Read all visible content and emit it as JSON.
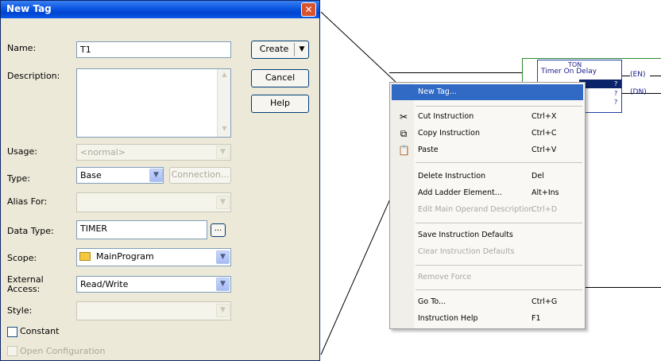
{
  "dialog": {
    "title": "New Tag",
    "name_label": "Name:",
    "name_value": "T1",
    "description_label": "Description:",
    "description_value": "",
    "usage_label": "Usage:",
    "usage_value": "<normal>",
    "type_label": "Type:",
    "type_value": "Base",
    "connection_button": "Connection...",
    "alias_label": "Alias For:",
    "alias_value": "",
    "datatype_label": "Data Type:",
    "datatype_value": "TIMER",
    "browse_button": "...",
    "scope_label": "Scope:",
    "scope_value": "MainProgram",
    "external_access_label": "External Access:",
    "external_access_value": "Read/Write",
    "style_label": "Style:",
    "style_value": "",
    "constant_label": "Constant",
    "open_config_label": "Open Configuration",
    "buttons": {
      "create": "Create",
      "cancel": "Cancel",
      "help": "Help"
    }
  },
  "ladder": {
    "instruction_mnemonic": "TON",
    "instruction_name": "Timer On Delay",
    "operand_placeholder": "?",
    "en_output": "EN",
    "dn_output": "DN"
  },
  "context_menu": {
    "items": [
      {
        "label": "New Tag...",
        "shortcut": "",
        "enabled": true,
        "highlighted": true,
        "icon": ""
      },
      {
        "label": "Cut Instruction",
        "shortcut": "Ctrl+X",
        "enabled": true,
        "icon": "scissors-icon"
      },
      {
        "label": "Copy Instruction",
        "shortcut": "Ctrl+C",
        "enabled": true,
        "icon": "copy-icon"
      },
      {
        "label": "Paste",
        "shortcut": "Ctrl+V",
        "enabled": true,
        "icon": "paste-icon"
      },
      {
        "label": "Delete Instruction",
        "shortcut": "Del",
        "enabled": true,
        "icon": ""
      },
      {
        "label": "Add Ladder Element...",
        "shortcut": "Alt+Ins",
        "enabled": true,
        "icon": ""
      },
      {
        "label": "Edit Main Operand Description",
        "shortcut": "Ctrl+D",
        "enabled": false,
        "icon": ""
      },
      {
        "label": "Save Instruction Defaults",
        "shortcut": "",
        "enabled": true,
        "icon": ""
      },
      {
        "label": "Clear Instruction Defaults",
        "shortcut": "",
        "enabled": false,
        "icon": ""
      },
      {
        "label": "Remove Force",
        "shortcut": "",
        "enabled": false,
        "icon": ""
      },
      {
        "label": "Go To...",
        "shortcut": "Ctrl+G",
        "enabled": true,
        "icon": ""
      },
      {
        "label": "Instruction Help",
        "shortcut": "F1",
        "enabled": true,
        "icon": ""
      }
    ]
  },
  "colors": {
    "titlebar_blue": "#0a55e0",
    "menu_highlight": "#316ac5",
    "dialog_background": "#ece9d8",
    "rung_green": "#2e8b2e"
  }
}
